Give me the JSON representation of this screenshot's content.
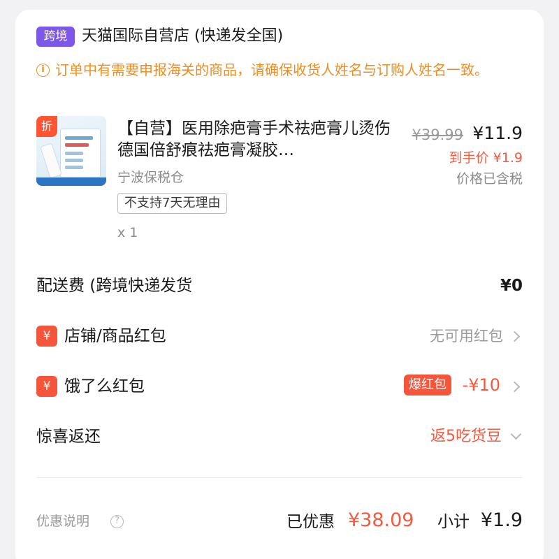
{
  "store": {
    "badge": "跨境",
    "name": "天猫国际自营店 (快递发全国)"
  },
  "notice": {
    "icon": "info-icon",
    "text": "订单中有需要申报海关的商品，请确保收货人姓名与订购人姓名一致。"
  },
  "product": {
    "discount_badge": "折",
    "title": "【自营】医用除疤膏手术祛疤膏儿烫伤德国倍舒痕祛疤膏凝胶…",
    "warehouse": "宁波保税仓",
    "tag": "不支持7天无理由",
    "quantity": "x 1",
    "original_price": "¥39.99",
    "price": "¥11.9",
    "hand_price": "到手价 ¥1.9",
    "tax_note": "价格已含税"
  },
  "shipping": {
    "label": "配送费 (跨境快递发货",
    "value": "¥0"
  },
  "store_coupon": {
    "icon": "yen-icon",
    "label": "店铺/商品红包",
    "value": "无可用红包"
  },
  "eleme_coupon": {
    "icon": "yen-icon",
    "label": "饿了么红包",
    "badge": "爆红包",
    "value": "-¥10"
  },
  "surprise": {
    "label": "惊喜返还",
    "value": "返5吃货豆"
  },
  "footer": {
    "promo_label": "优惠说明",
    "saved_label": "已优惠",
    "saved_value": "¥38.09",
    "subtotal_label": "小计",
    "subtotal_value": "¥1.9"
  },
  "colors": {
    "accent": "#f35a3e",
    "notice": "#ec8e21",
    "cross_badge": "#7d57e9"
  }
}
